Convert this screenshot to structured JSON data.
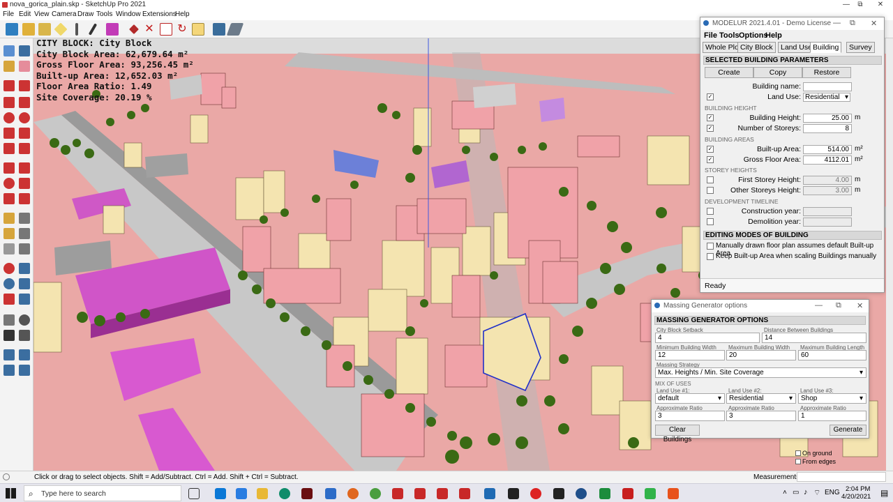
{
  "window": {
    "title": "nova_gorica_plain.skp - SketchUp Pro 2021",
    "min": "—",
    "max": "⧉",
    "close": "✕"
  },
  "menu": [
    "File",
    "Edit",
    "View",
    "Camera",
    "Draw",
    "Tools",
    "Window",
    "Extensions",
    "Help"
  ],
  "hud": {
    "line1": "CITY BLOCK: City Block",
    "line2": "City Block Area: 62,679.64 m²",
    "line3": "Gross Floor Area: 93,256.45 m²",
    "line4": "Built-up Area: 12,652.03 m²",
    "line5": "Floor Area Ratio: 1.49",
    "line6": "Site Coverage: 20.19 %"
  },
  "status": {
    "hint": "Click or drag to select objects. Shift = Add/Subtract. Ctrl = Add. Shift + Ctrl = Subtract.",
    "measurements": "Measurements"
  },
  "modelur": {
    "title": "MODELUR 2021.4.01 - Demo License",
    "menu": [
      "File",
      "Tools",
      "Options",
      "Help"
    ],
    "tabs": [
      "Whole Plot",
      "City Block",
      "Land Use",
      "Building",
      "Survey"
    ],
    "section_params": "SELECTED BUILDING PARAMETERS",
    "btn_create": "Create",
    "btn_copy": "Copy",
    "btn_restore": "Restore",
    "building_name_label": "Building name:",
    "land_use_label": "Land Use:",
    "land_use_value": "Residential",
    "sub_height": "BUILDING HEIGHT",
    "building_height_label": "Building Height:",
    "building_height_value": "25.00",
    "storeys_label": "Number of Storeys:",
    "storeys_value": "8",
    "sub_areas": "BUILDING AREAS",
    "builtup_label": "Built-up Area:",
    "builtup_value": "514.00",
    "gfa_label": "Gross Floor Area:",
    "gfa_value": "4112.01",
    "sub_storey": "STOREY HEIGHTS",
    "first_storey_label": "First Storey Height:",
    "first_storey_value": "4.00",
    "other_storeys_label": "Other Storeys Height:",
    "other_storeys_value": "3.00",
    "sub_timeline": "DEVELOPMENT TIMELINE",
    "construction_label": "Construction year:",
    "demolition_label": "Demolition year:",
    "section_editing": "EDITING MODES OF BUILDING",
    "mode1": "Manually drawn floor plan assumes default Built-up Area",
    "mode2": "Keep Built-up Area when scaling Buildings manually",
    "status": "Ready",
    "unit_m": "m",
    "unit_m2": "m²"
  },
  "massing": {
    "title": "Massing Generator options",
    "header": "MASSING GENERATOR OPTIONS",
    "setback_label": "City Block Setback",
    "setback_value": "4",
    "distance_label": "Distance Between Buildings",
    "distance_value": "14",
    "minw_label": "Minimum Building Width",
    "minw_value": "12",
    "maxw_label": "Maximum Building Width",
    "maxw_value": "20",
    "maxl_label": "Maximum Building Length",
    "maxl_value": "60",
    "strategy_label": "Massing Strategy",
    "strategy_value": "Max. Heights / Min. Site Coverage",
    "mix_label": "MIX OF USES",
    "lu1_label": "Land Use #1:",
    "lu1_value": "default",
    "lu2_label": "Land Use #2:",
    "lu2_value": "Residential",
    "lu3_label": "Land Use #3:",
    "lu3_value": "Shop",
    "ratio_label": "Approximate Ratio",
    "ratio1": "3",
    "ratio2": "3",
    "ratio3": "1",
    "clear_btn": "Clear Buildings",
    "generate_btn": "Generate"
  },
  "right_extras": {
    "on_ground": "On ground",
    "from_edges": "From edges"
  },
  "taskbar": {
    "search_placeholder": "Type here to search",
    "lang": "ENG",
    "time": "2:04 PM",
    "date": "4/20/2021"
  }
}
